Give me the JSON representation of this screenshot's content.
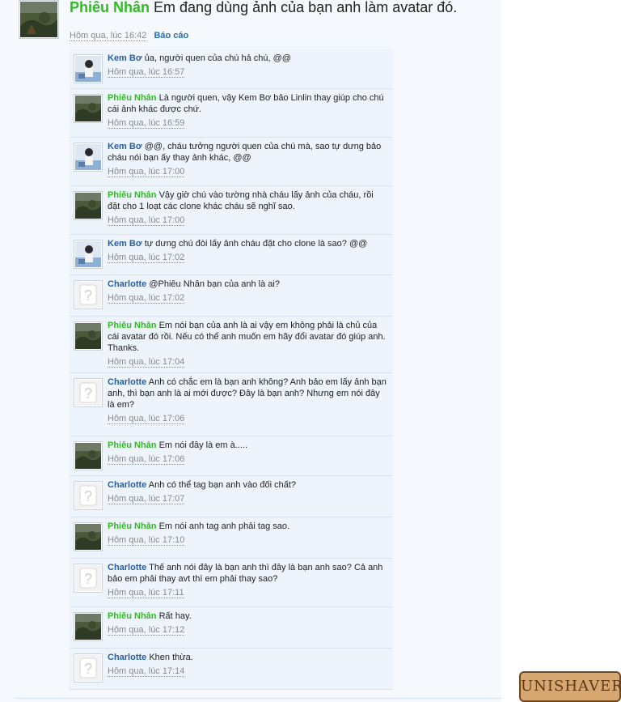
{
  "post": {
    "author": "Phiêu Nhân",
    "text": "Em đang dùng ảnh của bạn anh làm avatar đó.",
    "time": "Hôm qua, lúc 16:42",
    "report": "Báo cáo"
  },
  "comments": [
    {
      "name": "Kem Bơ",
      "avatar": "kem",
      "text": "ủa, người quen của chú hả chú, @@",
      "time": "Hôm qua, lúc 16:57"
    },
    {
      "name": "Phiêu Nhân",
      "avatar": "phieu",
      "text": "Là người quen, vậy Kem Bơ bảo Linlin thay giúp cho chú cái ảnh khác được chứ.",
      "time": "Hôm qua, lúc 16:59"
    },
    {
      "name": "Kem Bơ",
      "avatar": "kem",
      "text": "@@, cháu tưởng người quen của chú mà, sao tự dưng bảo cháu nói bạn ấy thay ảnh khác, @@",
      "time": "Hôm qua, lúc 17:00"
    },
    {
      "name": "Phiêu Nhân",
      "avatar": "phieu",
      "text": "Vậy giờ chú vào tường nhà cháu lấy ảnh của cháu, rồi đặt cho 1 loạt các clone khác cháu sẽ nghĩ sao.",
      "time": "Hôm qua, lúc 17:00"
    },
    {
      "name": "Kem Bơ",
      "avatar": "kem",
      "text": "tự dưng chú đòi lấy ảnh cháu đặt cho clone là sao? @@",
      "time": "Hôm qua, lúc 17:02"
    },
    {
      "name": "Charlotte",
      "avatar": "none",
      "text": "@Phiêu Nhân bạn của anh là ai?",
      "time": "Hôm qua, lúc 17:02"
    },
    {
      "name": "Phiêu Nhân",
      "avatar": "phieu",
      "text": "Em nói bạn của anh là ai vậy em không phải là chủ của cái avatar đó rồi. Nếu có thể anh muốn em hãy đổi avatar đó giúp anh. Thanks.",
      "time": "Hôm qua, lúc 17:04"
    },
    {
      "name": "Charlotte",
      "avatar": "none",
      "text": "Anh có chắc em là bạn anh không? Anh bảo em lấy ảnh bạn anh, thì bạn anh là ai mới được? Đây là bạn anh? Nhưng em nói đây là em?",
      "time": "Hôm qua, lúc 17:06"
    },
    {
      "name": "Phiêu Nhân",
      "avatar": "phieu",
      "text": "Em nói đây là em à.....",
      "time": "Hôm qua, lúc 17:06"
    },
    {
      "name": "Charlotte",
      "avatar": "none",
      "text": "Anh có thể tag bạn anh vào đối chất?",
      "time": "Hôm qua, lúc 17:07"
    },
    {
      "name": "Phiêu Nhân",
      "avatar": "phieu",
      "text": "Em nói anh tag anh phải tag sao.",
      "time": "Hôm qua, lúc 17:10"
    },
    {
      "name": "Charlotte",
      "avatar": "none",
      "text": "Thế anh nói đây là bạn anh thì đây là bạn anh sao? Cả anh bảo em phải thay avt thì em phải thay sao?",
      "time": "Hôm qua, lúc 17:11"
    },
    {
      "name": "Phiêu Nhân",
      "avatar": "phieu",
      "text": "Rất hay.",
      "time": "Hôm qua, lúc 17:12"
    },
    {
      "name": "Charlotte",
      "avatar": "none",
      "text": "Khen thừa.",
      "time": "Hôm qua, lúc 17:14"
    }
  ],
  "watermark": "UNISHAVER",
  "colors": {
    "green_name": "#2dbe1e",
    "blue_name": "#2a5f9e",
    "comment_bg": "#eef4fb"
  }
}
